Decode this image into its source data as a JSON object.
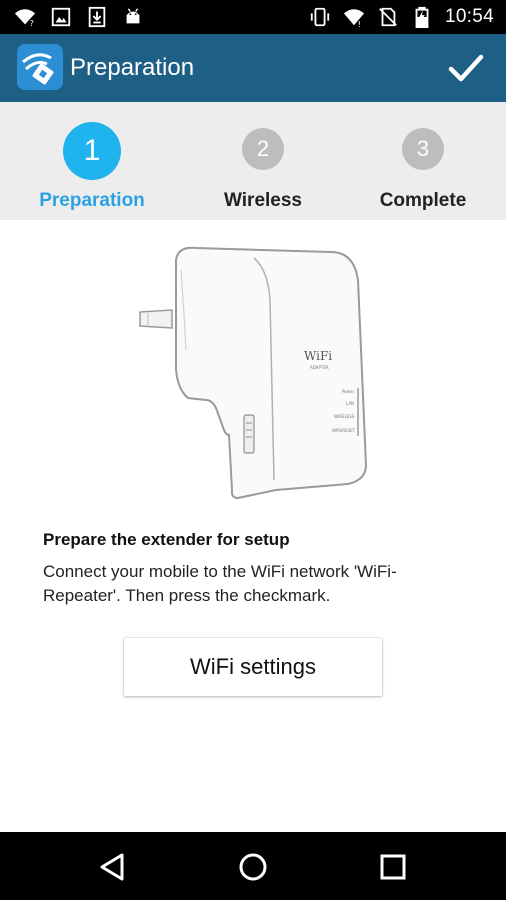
{
  "status_bar": {
    "time": "10:54",
    "left_icons": [
      "wifi-unknown-icon",
      "image-icon",
      "download-icon",
      "android-icon"
    ],
    "right_icons": [
      "vibrate-icon",
      "wifi-icon",
      "no-sim-icon",
      "battery-charging-icon"
    ]
  },
  "app_bar": {
    "title": "Preparation",
    "app_icon": "wifi-repeater-app-icon",
    "action_icon": "checkmark-icon"
  },
  "steps": [
    {
      "number": "1",
      "label": "Preparation",
      "active": true
    },
    {
      "number": "2",
      "label": "Wireless",
      "active": false
    },
    {
      "number": "3",
      "label": "Complete",
      "active": false
    }
  ],
  "illustration": {
    "brand": "WiFi",
    "sub": "ADAPTER",
    "indicators": [
      "Power",
      "LAN",
      "WIRELESS",
      "WPS/RESET"
    ]
  },
  "main": {
    "heading": "Prepare the extender for setup",
    "description": "Connect your mobile to the WiFi network 'WiFi-Repeater'. Then press the checkmark.",
    "button_label": "WiFi settings"
  },
  "navigation": {
    "icons": [
      "back-icon",
      "home-icon",
      "recents-icon"
    ]
  },
  "colors": {
    "app_bar": "#1e5f86",
    "accent": "#2ba3e3",
    "step_active": "#1fb4ee",
    "step_inactive": "#bdbdbd"
  }
}
